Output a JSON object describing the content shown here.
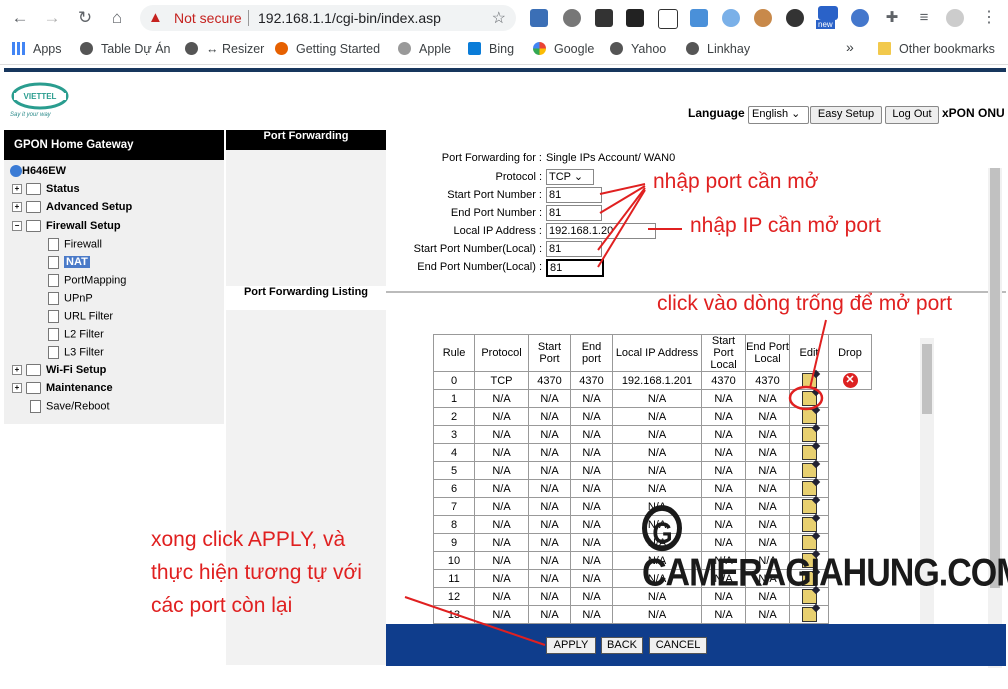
{
  "browser": {
    "security_warning": "Not secure",
    "url": "192.168.1.1/cgi-bin/index.asp",
    "bookmarks": [
      "Apps",
      "Table Dự Án",
      "↔ Resizer",
      "Getting Started",
      "Apple",
      "Bing",
      "Google",
      "Yahoo",
      "Linkhay"
    ],
    "more": "»",
    "other_bookmarks": "Other bookmarks",
    "ext_badge": "new"
  },
  "header": {
    "logo_tagline": "Say it your way",
    "language_label": "Language",
    "language_value": "English",
    "easy_setup": "Easy Setup",
    "logout": "Log Out",
    "brand": "xPON ONU"
  },
  "sidebar": {
    "title": "GPON Home Gateway",
    "device": "H646EW",
    "items": {
      "status": "Status",
      "advanced": "Advanced Setup",
      "firewall_setup": "Firewall Setup",
      "firewall": "Firewall",
      "nat": "NAT",
      "portmapping": "PortMapping",
      "upnp": "UPnP",
      "url_filter": "URL Filter",
      "l2_filter": "L2 Filter",
      "l3_filter": "L3 Filter",
      "wifi": "Wi-Fi Setup",
      "maintenance": "Maintenance",
      "save": "Save/Reboot"
    }
  },
  "main": {
    "section_title": "Port Forwarding",
    "listing_title": "Port Forwarding Listing",
    "form": {
      "for_label": "Port Forwarding for :",
      "for_value": "Single IPs Account/ WAN0",
      "protocol_label": "Protocol :",
      "protocol_value": "TCP",
      "start_port_label": "Start Port Number :",
      "start_port_value": "81",
      "end_port_label": "End Port Number :",
      "end_port_value": "81",
      "ip_label": "Local IP Address :",
      "ip_value": "192.168.1.20",
      "start_local_label": "Start Port Number(Local) :",
      "start_local_value": "81",
      "end_local_label": "End Port Number(Local) :",
      "end_local_value": "81"
    },
    "table": {
      "headers": [
        "Rule",
        "Protocol",
        "Start Port",
        "End port",
        "Local IP Address",
        "Start Port Local",
        "End Port Local",
        "Edit",
        "Drop"
      ],
      "rows": [
        [
          "0",
          "TCP",
          "4370",
          "4370",
          "192.168.1.201",
          "4370",
          "4370"
        ],
        [
          "1",
          "N/A",
          "N/A",
          "N/A",
          "N/A",
          "N/A",
          "N/A"
        ],
        [
          "2",
          "N/A",
          "N/A",
          "N/A",
          "N/A",
          "N/A",
          "N/A"
        ],
        [
          "3",
          "N/A",
          "N/A",
          "N/A",
          "N/A",
          "N/A",
          "N/A"
        ],
        [
          "4",
          "N/A",
          "N/A",
          "N/A",
          "N/A",
          "N/A",
          "N/A"
        ],
        [
          "5",
          "N/A",
          "N/A",
          "N/A",
          "N/A",
          "N/A",
          "N/A"
        ],
        [
          "6",
          "N/A",
          "N/A",
          "N/A",
          "N/A",
          "N/A",
          "N/A"
        ],
        [
          "7",
          "N/A",
          "N/A",
          "N/A",
          "N/A",
          "N/A",
          "N/A"
        ],
        [
          "8",
          "N/A",
          "N/A",
          "N/A",
          "N/A",
          "N/A",
          "N/A"
        ],
        [
          "9",
          "N/A",
          "N/A",
          "N/A",
          "N/A",
          "N/A",
          "N/A"
        ],
        [
          "10",
          "N/A",
          "N/A",
          "N/A",
          "N/A",
          "N/A",
          "N/A"
        ],
        [
          "11",
          "N/A",
          "N/A",
          "N/A",
          "N/A",
          "N/A",
          "N/A"
        ],
        [
          "12",
          "N/A",
          "N/A",
          "N/A",
          "N/A",
          "N/A",
          "N/A"
        ],
        [
          "13",
          "N/A",
          "N/A",
          "N/A",
          "N/A",
          "N/A",
          "N/A"
        ]
      ]
    },
    "buttons": {
      "apply": "APPLY",
      "back": "BACK",
      "cancel": "CANCEL"
    }
  },
  "annotations": {
    "port": "nhập port cần mở",
    "ip": "nhập IP cần mở port",
    "click_row": "click vào dòng trống để mở port",
    "apply_1": "xong click APPLY, và",
    "apply_2": "thực hiện tương tự với",
    "apply_3": "các port còn lại"
  },
  "watermark": "CAMERAGIAHUNG.COM",
  "watermark_letter": "G",
  "colors": {
    "annotation": "#e02020",
    "footer": "#0f3d8c",
    "header_line": "#17365d"
  }
}
